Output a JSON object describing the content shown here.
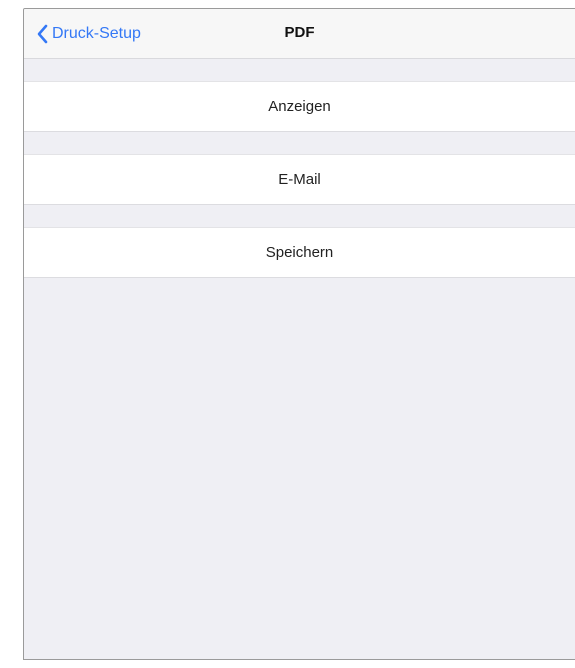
{
  "navbar": {
    "back_label": "Druck-Setup",
    "title": "PDF",
    "accent_color": "#3478f6"
  },
  "options": [
    {
      "label": "Anzeigen"
    },
    {
      "label": "E-Mail"
    },
    {
      "label": "Speichern"
    }
  ],
  "icons": {
    "back": "chevron-left-icon"
  }
}
